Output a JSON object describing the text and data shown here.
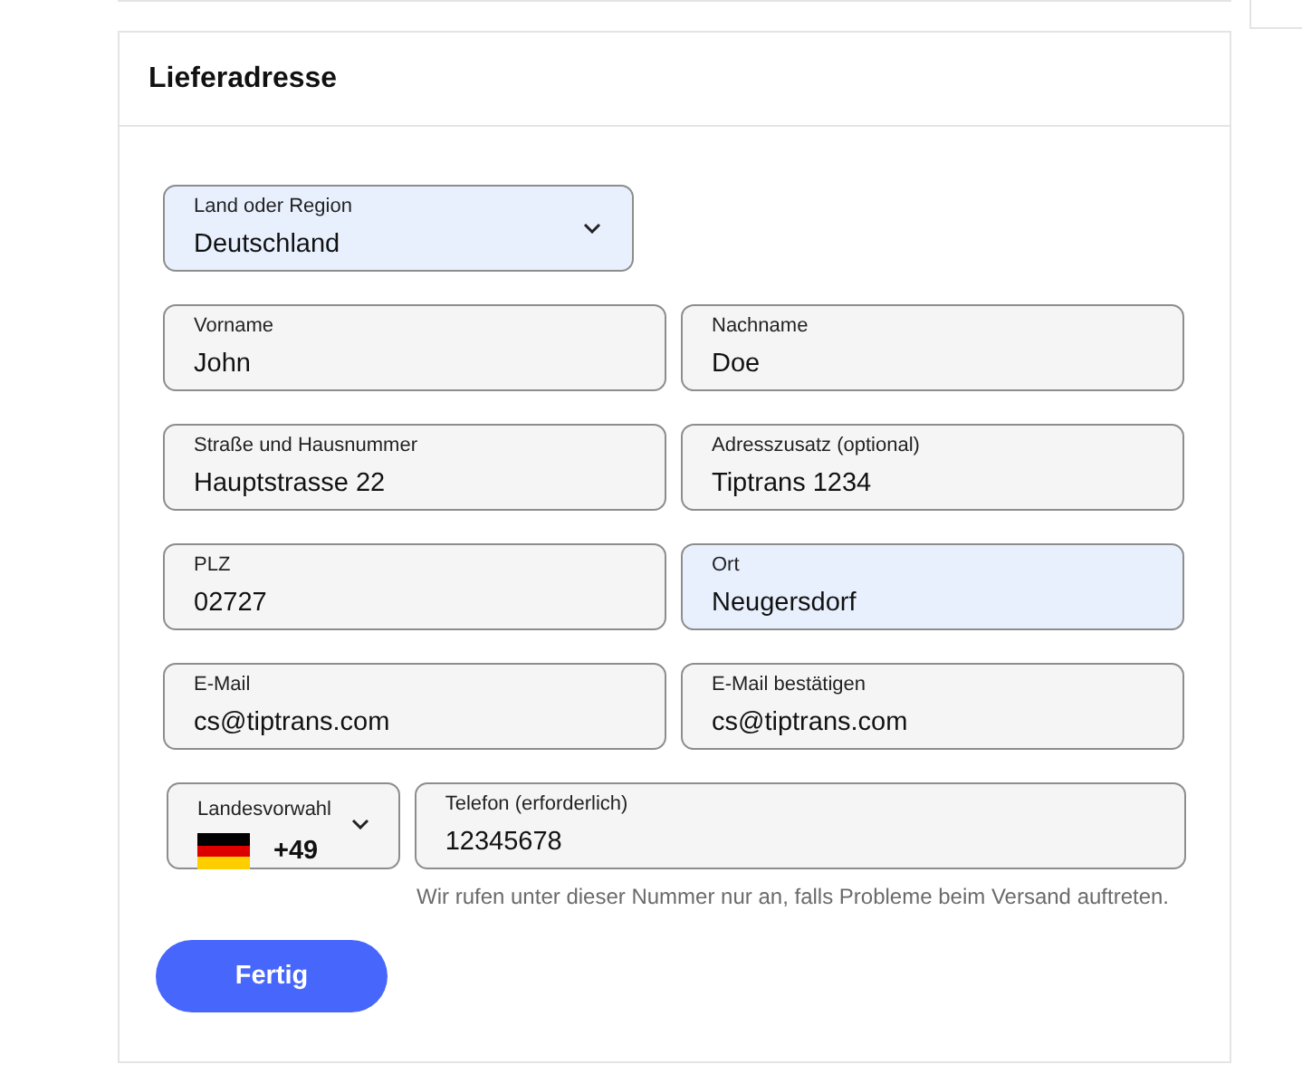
{
  "card": {
    "title": "Lieferadresse"
  },
  "country_select": {
    "label": "Land oder Region",
    "value": "Deutschland",
    "autofilled": true
  },
  "field_rows": [
    [
      {
        "label": "Vorname",
        "value": "John",
        "autofilled": false
      },
      {
        "label": "Nachname",
        "value": "Doe",
        "autofilled": false
      }
    ],
    [
      {
        "label": "Straße und Hausnummer",
        "value": "Hauptstrasse 22",
        "autofilled": false
      },
      {
        "label": "Adresszusatz (optional)",
        "value": "Tiptrans 1234",
        "autofilled": false
      }
    ],
    [
      {
        "label": "PLZ",
        "value": "02727",
        "autofilled": false
      },
      {
        "label": "Ort",
        "value": "Neugersdorf",
        "autofilled": true
      }
    ],
    [
      {
        "label": "E-Mail",
        "value": "cs@tiptrans.com",
        "autofilled": false
      },
      {
        "label": "E-Mail bestätigen",
        "value": "cs@tiptrans.com",
        "autofilled": false
      }
    ]
  ],
  "dial_code_select": {
    "label": "Landesvorwahl",
    "value": "+49"
  },
  "phone_field": {
    "label": "Telefon (erforderlich)",
    "value": "12345678",
    "hint": "Wir rufen unter dieser Nummer nur an, falls Probleme beim Versand auftreten."
  },
  "submit_button": {
    "label": "Fertig"
  }
}
